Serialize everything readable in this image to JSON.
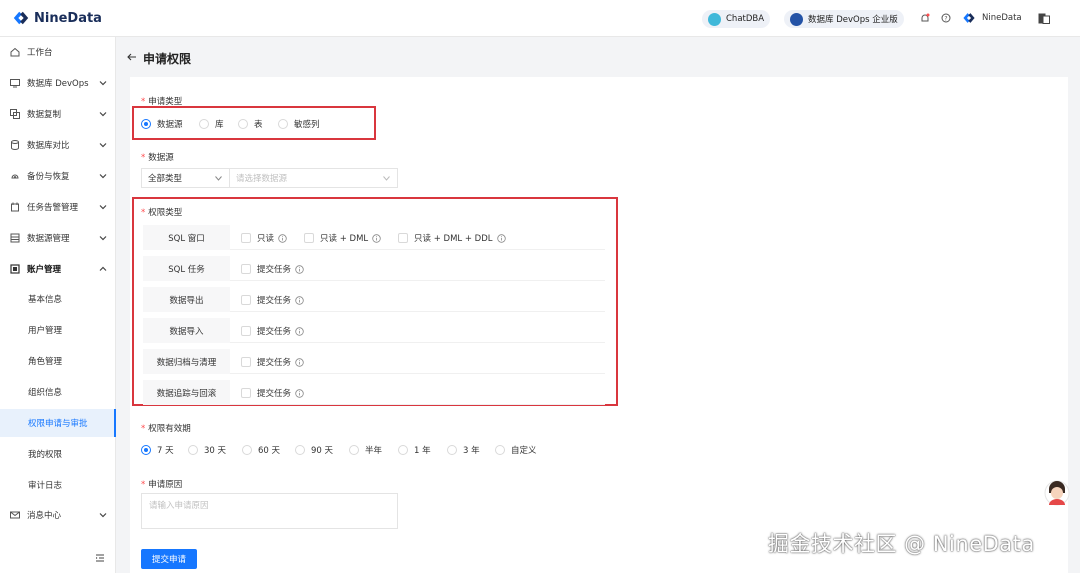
{
  "app": {
    "name": "NineData"
  },
  "topbar": {
    "chatdba": "ChatDBA",
    "product": "数据库 DevOps 企业版",
    "user": "NineData",
    "colors": {
      "brand": "#1677ff",
      "chatdba_icon": "#3fb8d9",
      "devops_icon": "#2453a6"
    }
  },
  "sidebar": {
    "items": [
      {
        "label": "工作台",
        "icon": "home-icon"
      },
      {
        "label": "数据库 DevOps",
        "icon": "monitor-icon"
      },
      {
        "label": "数据复制",
        "icon": "copy-icon"
      },
      {
        "label": "数据库对比",
        "icon": "compare-icon"
      },
      {
        "label": "备份与恢复",
        "icon": "backup-icon"
      },
      {
        "label": "任务告警管理",
        "icon": "alarm-icon"
      },
      {
        "label": "数据源管理",
        "icon": "datasource-icon"
      },
      {
        "label": "账户管理",
        "icon": "account-icon"
      }
    ],
    "account_sub": [
      "基本信息",
      "用户管理",
      "角色管理",
      "组织信息",
      "权限申请与审批",
      "我的权限",
      "审计日志"
    ],
    "message_center": "消息中心"
  },
  "page": {
    "title": "申请权限",
    "apply_type": {
      "label": "申请类型",
      "options": [
        "数据源",
        "库",
        "表",
        "敏感列"
      ],
      "selected": "数据源"
    },
    "datasource": {
      "label": "数据源",
      "type_value": "全部类型",
      "placeholder": "请选择数据源"
    },
    "permission_type": {
      "label": "权限类型",
      "rows": [
        {
          "name": "SQL 窗口",
          "options": [
            "只读",
            "只读 + DML",
            "只读 + DML + DDL"
          ]
        },
        {
          "name": "SQL 任务",
          "options": [
            "提交任务"
          ]
        },
        {
          "name": "数据导出",
          "options": [
            "提交任务"
          ]
        },
        {
          "name": "数据导入",
          "options": [
            "提交任务"
          ]
        },
        {
          "name": "数据归档与清理",
          "options": [
            "提交任务"
          ]
        },
        {
          "name": "数据追踪与回滚",
          "options": [
            "提交任务"
          ]
        }
      ]
    },
    "validity": {
      "label": "权限有效期",
      "options": [
        "7 天",
        "30 天",
        "60 天",
        "90 天",
        "半年",
        "1 年",
        "3 年",
        "自定义"
      ],
      "selected": "7 天"
    },
    "reason": {
      "label": "申请原因",
      "placeholder": "请输入申请原因"
    },
    "submit_label": "提交申请"
  },
  "watermark": "掘金技术社区 @ NineData"
}
